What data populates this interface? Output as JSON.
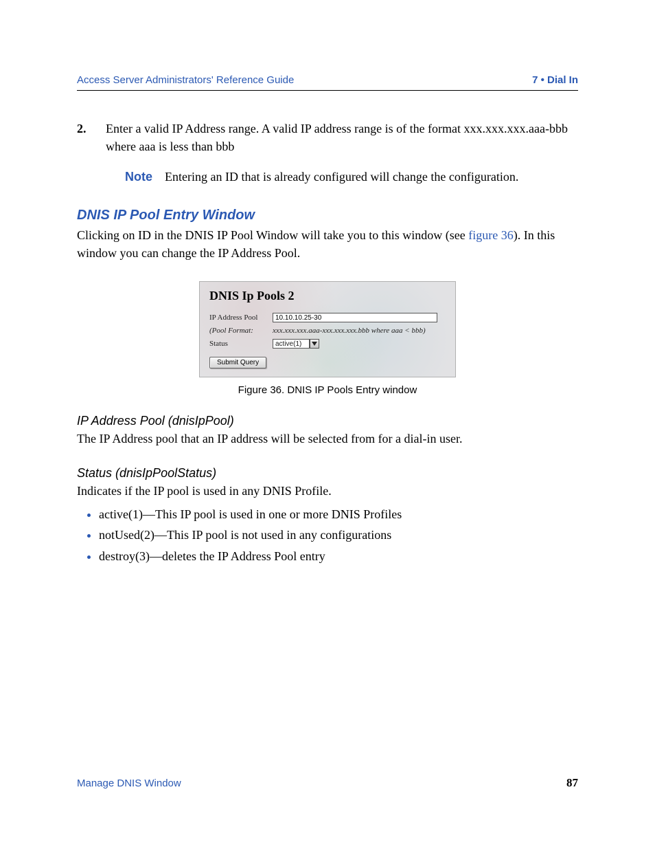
{
  "header": {
    "left": "Access Server Administrators' Reference Guide",
    "right": "7 • Dial In"
  },
  "step": {
    "number": "2.",
    "text": "Enter a valid IP Address range. A valid IP address range is of the format xxx.xxx.xxx.aaa-bbb where aaa is less than bbb"
  },
  "note": {
    "label": "Note",
    "text": "Entering an ID that is already configured will change the configuration."
  },
  "section": {
    "title": "DNIS IP Pool Entry Window",
    "para_pre": "Clicking on ID in the DNIS IP Pool Window will take you to this window (see ",
    "link": "figure 36",
    "para_post": "). In this window you can change the IP Address Pool."
  },
  "figure": {
    "title": "DNIS Ip Pools 2",
    "rows": {
      "ip_label": "IP Address Pool",
      "ip_value": "10.10.10.25-30",
      "format_label": "(Pool Format:",
      "format_value": "xxx.xxx.xxx.aaa-xxx.xxx.xxx.bbb where aaa < bbb)",
      "status_label": "Status",
      "status_value": "active(1)"
    },
    "button": "Submit Query",
    "caption": "Figure 36. DNIS IP Pools Entry window"
  },
  "sub1": {
    "title": "IP Address Pool (dnisIpPool)",
    "text": "The IP Address pool that an IP address will be selected from for a dial-in user."
  },
  "sub2": {
    "title": "Status (dnisIpPoolStatus)",
    "text": "Indicates if the IP pool is used in any DNIS Profile.",
    "items": [
      "active(1)—This IP pool is used in one or more DNIS Profiles",
      "notUsed(2)—This IP pool is not used in any configurations",
      "destroy(3)—deletes the IP Address Pool entry"
    ]
  },
  "footer": {
    "left": "Manage DNIS Window",
    "page": "87"
  }
}
